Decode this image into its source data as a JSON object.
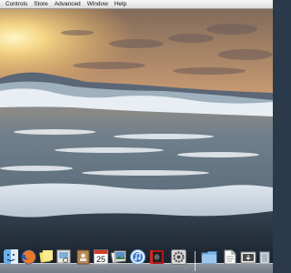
{
  "menubar": {
    "items": [
      "Controls",
      "Store",
      "Advanced",
      "Window",
      "Help"
    ]
  },
  "wallpaper": {
    "description_colors": {
      "sky_top": "#8a6a58",
      "sun": "#fff2b0",
      "sea": "#6d7f8e",
      "foam": "#f3f6f8",
      "sand": "#1d2733"
    }
  },
  "dock": {
    "items": [
      {
        "name": "finder-icon"
      },
      {
        "name": "firefox-icon"
      },
      {
        "name": "stickies-icon"
      },
      {
        "name": "preview-icon"
      },
      {
        "name": "address-book-icon"
      },
      {
        "name": "ical-icon",
        "label": "25"
      },
      {
        "name": "photos-icon"
      },
      {
        "name": "itunes-icon"
      },
      {
        "name": "photo-booth-icon"
      },
      {
        "name": "system-preferences-icon"
      },
      {
        "name": "folder-icon"
      },
      {
        "name": "document-icon"
      },
      {
        "name": "downloads-icon"
      },
      {
        "name": "trash-icon"
      }
    ]
  }
}
